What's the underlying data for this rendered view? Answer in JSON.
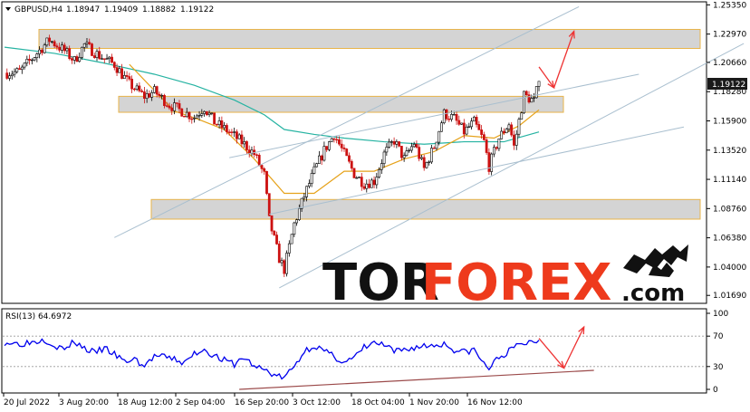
{
  "header": {
    "symbol": "GBPUSD,H4",
    "ohlc": [
      "1.18947",
      "1.19409",
      "1.18882",
      "1.19122"
    ]
  },
  "rsi_header": "RSI(13) 64.6972",
  "watermark": {
    "part1": "TOR",
    "part2": "FOREX",
    "part3": ".com"
  },
  "colors": {
    "bull": "#000000",
    "bear": "#cc1111",
    "ma_fast": "#e6a21a",
    "ma_slow": "#26b3a2",
    "rsi": "#0000ee",
    "zone_fill": "#d4d4d4",
    "zone_border": "#e8b44a",
    "channel": "#a9bfcf",
    "arrow": "#ee3333",
    "rsi_trend": "#9b4a4a",
    "price_label_bg": "#1a1a1a"
  },
  "chart_data": {
    "type": "candlestick",
    "symbol": "GBPUSD",
    "timeframe": "H4",
    "last_price": 1.19122,
    "last_price_label": "1.19122",
    "y_ticks": [
      "1.25350",
      "1.22970",
      "1.20660",
      "1.18280",
      "1.15900",
      "1.13520",
      "1.11140",
      "1.08760",
      "1.06380",
      "1.04000",
      "1.01690"
    ],
    "ylim": [
      1.0119,
      1.2545
    ],
    "x_ticks": [
      "20 Jul 2022",
      "3 Aug 20:00",
      "18 Aug 12:00",
      "2 Sep 04:00",
      "16 Sep 20:00",
      "3 Oct 12:00",
      "18 Oct 04:00",
      "1 Nov 20:00",
      "16 Nov 12:00"
    ],
    "price_path": [
      [
        0,
        1.198
      ],
      [
        3,
        1.199
      ],
      [
        6,
        1.212
      ],
      [
        9,
        1.225
      ],
      [
        12,
        1.216
      ],
      [
        14,
        1.208
      ],
      [
        16,
        1.221
      ],
      [
        19,
        1.212
      ],
      [
        22,
        1.205
      ],
      [
        25,
        1.189
      ],
      [
        28,
        1.179
      ],
      [
        30,
        1.183
      ],
      [
        33,
        1.172
      ],
      [
        36,
        1.166
      ],
      [
        38,
        1.162
      ],
      [
        40,
        1.17
      ],
      [
        42,
        1.158
      ],
      [
        45,
        1.15
      ],
      [
        48,
        1.14
      ],
      [
        50,
        1.132
      ],
      [
        52,
        1.115
      ],
      [
        53,
        1.078
      ],
      [
        55,
        1.047
      ],
      [
        56,
        1.038
      ],
      [
        58,
        1.075
      ],
      [
        60,
        1.098
      ],
      [
        62,
        1.118
      ],
      [
        64,
        1.135
      ],
      [
        66,
        1.148
      ],
      [
        68,
        1.132
      ],
      [
        70,
        1.116
      ],
      [
        72,
        1.108
      ],
      [
        74,
        1.11
      ],
      [
        76,
        1.132
      ],
      [
        78,
        1.143
      ],
      [
        80,
        1.128
      ],
      [
        82,
        1.141
      ],
      [
        84,
        1.12
      ],
      [
        86,
        1.138
      ],
      [
        88,
        1.165
      ],
      [
        90,
        1.161
      ],
      [
        92,
        1.15
      ],
      [
        94,
        1.158
      ],
      [
        96,
        1.142
      ],
      [
        97,
        1.122
      ],
      [
        99,
        1.145
      ],
      [
        101,
        1.157
      ],
      [
        102,
        1.138
      ],
      [
        104,
        1.18
      ],
      [
        106,
        1.175
      ],
      [
        107,
        1.191
      ]
    ],
    "ma_fast_path": [
      [
        25,
        1.205
      ],
      [
        29,
        1.188
      ],
      [
        34,
        1.167
      ],
      [
        39,
        1.16
      ],
      [
        44,
        1.152
      ],
      [
        50,
        1.128
      ],
      [
        56,
        1.1
      ],
      [
        62,
        1.1
      ],
      [
        68,
        1.118
      ],
      [
        74,
        1.118
      ],
      [
        80,
        1.128
      ],
      [
        86,
        1.134
      ],
      [
        92,
        1.147
      ],
      [
        98,
        1.145
      ],
      [
        103,
        1.155
      ],
      [
        107,
        1.168
      ]
    ],
    "ma_slow_path": [
      [
        0,
        1.219
      ],
      [
        10,
        1.214
      ],
      [
        20,
        1.206
      ],
      [
        30,
        1.197
      ],
      [
        38,
        1.188
      ],
      [
        46,
        1.176
      ],
      [
        52,
        1.164
      ],
      [
        56,
        1.152
      ],
      [
        62,
        1.148
      ],
      [
        68,
        1.145
      ],
      [
        76,
        1.142
      ],
      [
        84,
        1.14
      ],
      [
        92,
        1.142
      ],
      [
        100,
        1.142
      ],
      [
        107,
        1.15
      ]
    ],
    "zones": [
      [
        1.218,
        1.2335
      ],
      [
        1.166,
        1.179
      ],
      [
        1.079,
        1.095
      ]
    ],
    "channel_lines": [
      [
        [
          22,
          1.064
        ],
        [
          115,
          1.252
        ]
      ],
      [
        [
          45,
          1.129
        ],
        [
          127,
          1.197
        ]
      ],
      [
        [
          53,
          1.083
        ],
        [
          136,
          1.154
        ]
      ],
      [
        [
          55,
          1.023
        ],
        [
          148,
          1.222
        ]
      ]
    ],
    "forecast_arrows": [
      [
        [
          107,
          1.203
        ],
        [
          110,
          1.186
        ]
      ],
      [
        [
          110,
          1.186
        ],
        [
          114,
          1.232
        ]
      ]
    ],
    "rsi": {
      "period": 13,
      "value": 64.6972,
      "levels": [
        30,
        70
      ],
      "y_ticks": [
        "100",
        "70",
        "30",
        "0"
      ],
      "ylim": [
        0,
        100
      ],
      "path": [
        [
          0,
          62
        ],
        [
          3,
          60
        ],
        [
          6,
          63
        ],
        [
          8,
          66
        ],
        [
          10,
          58
        ],
        [
          12,
          52
        ],
        [
          14,
          63
        ],
        [
          16,
          54
        ],
        [
          18,
          48
        ],
        [
          20,
          54
        ],
        [
          22,
          46
        ],
        [
          24,
          36
        ],
        [
          26,
          40
        ],
        [
          28,
          30
        ],
        [
          30,
          44
        ],
        [
          32,
          42
        ],
        [
          34,
          40
        ],
        [
          36,
          34
        ],
        [
          38,
          47
        ],
        [
          40,
          53
        ],
        [
          42,
          44
        ],
        [
          44,
          38
        ],
        [
          46,
          33
        ],
        [
          48,
          42
        ],
        [
          50,
          30
        ],
        [
          52,
          26
        ],
        [
          54,
          19
        ],
        [
          56,
          15
        ],
        [
          58,
          30
        ],
        [
          60,
          50
        ],
        [
          62,
          58
        ],
        [
          64,
          50
        ],
        [
          66,
          43
        ],
        [
          68,
          36
        ],
        [
          70,
          41
        ],
        [
          72,
          55
        ],
        [
          74,
          61
        ],
        [
          76,
          58
        ],
        [
          78,
          49
        ],
        [
          80,
          52
        ],
        [
          82,
          55
        ],
        [
          84,
          57
        ],
        [
          86,
          58
        ],
        [
          88,
          60
        ],
        [
          90,
          52
        ],
        [
          92,
          49
        ],
        [
          94,
          52
        ],
        [
          96,
          33
        ],
        [
          97,
          28
        ],
        [
          99,
          42
        ],
        [
          101,
          50
        ],
        [
          103,
          59
        ],
        [
          105,
          62
        ],
        [
          107,
          64.7
        ]
      ],
      "trend_line": [
        [
          47,
          0
        ],
        [
          118,
          25
        ]
      ],
      "arrows": [
        [
          [
            107,
            67
          ],
          [
            112,
            28
          ]
        ],
        [
          [
            112,
            28
          ],
          [
            116,
            82
          ]
        ]
      ]
    }
  }
}
